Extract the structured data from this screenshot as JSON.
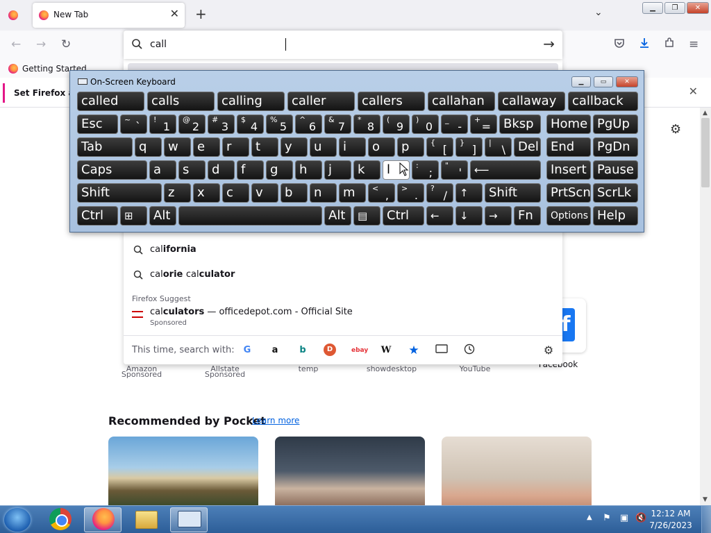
{
  "browser": {
    "tab_title": "New Tab",
    "url_query": "call",
    "bookmark_getting_started": "Getting Started",
    "notification_text": "Set Firefox as y"
  },
  "dropdown": {
    "suggestions": [
      {
        "prefix": "cal",
        "rest": "ifornia"
      },
      {
        "prefix": "cal",
        "rest": "orie ",
        "prefix2": "cal",
        "rest2": "culator"
      }
    ],
    "firefox_suggest_label": "Firefox Suggest",
    "sponsored_suggestion": {
      "prefix": "cal",
      "rest": "culators",
      "suffix": " — officedepot.com - Official Site",
      "tag": "Sponsored"
    },
    "oneoff_label": "This time, search with:",
    "engines": [
      "google-icon",
      "amazon-icon",
      "bing-icon",
      "duckduckgo-icon",
      "ebay-icon",
      "wikipedia-icon",
      "bookmarks-star-icon",
      "tabs-icon",
      "history-icon"
    ]
  },
  "newtab": {
    "shortcuts": [
      {
        "label": "Amazon",
        "sub": "Sponsored"
      },
      {
        "label": "Allstate",
        "sub": "Sponsored"
      },
      {
        "label": "temp",
        "sub": ""
      },
      {
        "label": "showdesktop",
        "sub": ""
      },
      {
        "label": "YouTube",
        "sub": ""
      },
      {
        "label": "Facebook",
        "sub": ""
      }
    ],
    "pocket_title": "Recommended by Pocket",
    "pocket_learn_more": "Learn more"
  },
  "osk": {
    "title": "On-Screen Keyboard",
    "predictions": [
      "called",
      "calls",
      "calling",
      "caller",
      "callers",
      "callahan",
      "callaway",
      "callback"
    ],
    "keys": {
      "esc": "Esc",
      "bksp": "Bksp",
      "home": "Home",
      "pgup": "PgUp",
      "tab": "Tab",
      "del": "Del",
      "end": "End",
      "pgdn": "PgDn",
      "caps": "Caps",
      "insert": "Insert",
      "pause": "Pause",
      "shift": "Shift",
      "prtscn": "PrtScn",
      "scrlk": "ScrLk",
      "ctrl": "Ctrl",
      "alt": "Alt",
      "fn": "Fn",
      "options": "Options",
      "help": "Help"
    }
  },
  "taskbar": {
    "time": "12:12 AM",
    "date": "7/26/2023"
  }
}
